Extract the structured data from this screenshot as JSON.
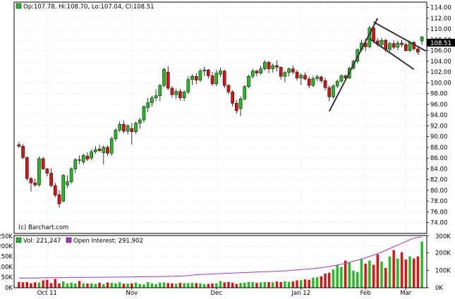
{
  "chart_data": [
    {
      "type": "candlestick",
      "legend": {
        "text": "Op:107.78, Hi:108.70, Lo:107.04, Cl:108.51",
        "color": "#22bb22"
      },
      "watermark": "(c) Barchart.com",
      "last_price_label": "108.51",
      "ylim": [
        72,
        115
      ],
      "y_ticks": [
        "74.00",
        "76.00",
        "78.00",
        "80.00",
        "82.00",
        "84.00",
        "86.00",
        "88.00",
        "90.00",
        "92.00",
        "94.00",
        "96.00",
        "98.00",
        "100.00",
        "102.00",
        "104.00",
        "106.00",
        "108.00",
        "110.00",
        "112.00",
        "114.00"
      ],
      "x_labels": [
        "Oct 11",
        "Nov",
        "Dec",
        "Jan 12",
        "Feb",
        "Mar"
      ],
      "up_color": "#22bb22",
      "down_color": "#dd1111",
      "candles": [
        [
          88.5,
          89.0,
          87.9,
          88.2
        ],
        [
          88.2,
          88.6,
          85.8,
          86.1
        ],
        [
          86.1,
          86.3,
          81.8,
          82.2
        ],
        [
          82.2,
          82.5,
          79.8,
          81.4
        ],
        [
          81.4,
          82.2,
          80.6,
          81.0
        ],
        [
          81.0,
          86.3,
          80.7,
          85.9
        ],
        [
          85.9,
          86.2,
          83.8,
          84.0
        ],
        [
          84.0,
          84.2,
          82.6,
          83.2
        ],
        [
          83.2,
          84.1,
          80.6,
          80.9
        ],
        [
          80.9,
          81.4,
          78.7,
          79.1
        ],
        [
          79.2,
          80.0,
          76.8,
          77.5
        ],
        [
          78.0,
          83.0,
          77.8,
          82.8
        ],
        [
          81.0,
          82.8,
          80.4,
          81.6
        ],
        [
          81.6,
          84.3,
          81.2,
          84.0
        ],
        [
          84.0,
          86.0,
          83.2,
          85.7
        ],
        [
          85.7,
          86.5,
          84.9,
          85.6
        ],
        [
          85.3,
          86.8,
          84.8,
          86.5
        ],
        [
          86.4,
          87.1,
          85.4,
          85.8
        ],
        [
          86.0,
          87.6,
          85.6,
          87.2
        ],
        [
          87.2,
          88.2,
          86.8,
          87.6
        ],
        [
          87.7,
          88.5,
          87.1,
          87.4
        ],
        [
          87.0,
          88.4,
          84.8,
          88.0
        ],
        [
          88.0,
          88.4,
          86.4,
          86.9
        ],
        [
          86.9,
          90.0,
          86.4,
          89.6
        ],
        [
          89.6,
          91.6,
          89.1,
          91.2
        ],
        [
          91.2,
          92.8,
          90.8,
          92.3
        ],
        [
          92.3,
          93.0,
          90.6,
          91.0
        ],
        [
          91.0,
          92.3,
          90.4,
          92.0
        ],
        [
          91.5,
          92.5,
          88.5,
          90.9
        ],
        [
          90.9,
          92.8,
          90.5,
          92.5
        ],
        [
          92.5,
          93.5,
          91.5,
          93.1
        ],
        [
          93.1,
          95.8,
          92.6,
          95.6
        ],
        [
          95.4,
          97.2,
          94.6,
          96.3
        ],
        [
          96.3,
          97.6,
          95.6,
          97.2
        ],
        [
          97.2,
          98.8,
          96.6,
          97.6
        ],
        [
          97.6,
          99.8,
          96.6,
          99.5
        ],
        [
          99.5,
          102.8,
          99.2,
          102.5
        ],
        [
          102.0,
          103.1,
          98.6,
          99.0
        ],
        [
          99.0,
          99.4,
          97.2,
          97.8
        ],
        [
          97.8,
          98.9,
          97.0,
          98.4
        ],
        [
          98.4,
          98.9,
          96.7,
          97.2
        ],
        [
          97.2,
          98.6,
          96.6,
          98.3
        ],
        [
          98.3,
          101.2,
          97.9,
          100.6
        ],
        [
          100.6,
          101.6,
          99.6,
          101.2
        ],
        [
          101.2,
          101.8,
          99.8,
          100.5
        ],
        [
          100.5,
          102.6,
          100.2,
          102.2
        ],
        [
          102.2,
          103.0,
          101.3,
          102.4
        ],
        [
          102.4,
          102.6,
          100.8,
          101.3
        ],
        [
          101.3,
          102.0,
          99.4,
          99.8
        ],
        [
          99.8,
          102.4,
          99.4,
          101.8
        ],
        [
          101.6,
          102.8,
          101.1,
          102.2
        ],
        [
          102.2,
          102.4,
          99.0,
          99.5
        ],
        [
          99.5,
          99.8,
          97.8,
          98.3
        ],
        [
          98.3,
          98.6,
          95.6,
          96.2
        ],
        [
          96.2,
          96.8,
          94.3,
          94.8
        ],
        [
          95.2,
          97.5,
          93.8,
          97.0
        ],
        [
          97.0,
          99.6,
          96.8,
          99.3
        ],
        [
          99.3,
          101.5,
          99.0,
          101.2
        ],
        [
          101.2,
          102.6,
          100.8,
          102.2
        ],
        [
          102.2,
          102.4,
          101.2,
          101.8
        ],
        [
          101.8,
          103.2,
          101.5,
          102.6
        ],
        [
          102.6,
          104.2,
          102.3,
          103.8
        ],
        [
          103.8,
          104.1,
          101.8,
          102.6
        ],
        [
          102.6,
          103.6,
          101.9,
          103.2
        ],
        [
          103.2,
          104.2,
          102.1,
          102.9
        ],
        [
          102.9,
          103.0,
          100.6,
          101.2
        ],
        [
          101.2,
          102.2,
          100.1,
          101.9
        ],
        [
          101.9,
          102.8,
          101.2,
          102.6
        ],
        [
          102.6,
          103.2,
          101.6,
          102.0
        ],
        [
          102.0,
          102.4,
          100.4,
          100.9
        ],
        [
          100.9,
          101.8,
          99.6,
          101.4
        ],
        [
          101.4,
          101.9,
          100.5,
          100.7
        ],
        [
          100.7,
          101.2,
          99.0,
          99.5
        ],
        [
          99.5,
          101.3,
          99.2,
          100.8
        ],
        [
          100.8,
          101.5,
          100.3,
          101.1
        ],
        [
          101.1,
          101.3,
          100.0,
          100.4
        ],
        [
          100.4,
          100.9,
          98.6,
          99.1
        ],
        [
          99.1,
          99.5,
          96.6,
          97.4
        ],
        [
          97.4,
          99.7,
          97.1,
          99.4
        ],
        [
          99.4,
          100.6,
          99.0,
          100.3
        ],
        [
          100.3,
          101.6,
          100.0,
          101.3
        ],
        [
          101.3,
          101.5,
          100.6,
          100.9
        ],
        [
          100.9,
          103.0,
          100.7,
          102.7
        ],
        [
          102.7,
          104.3,
          102.4,
          104.0
        ],
        [
          104.0,
          106.4,
          103.6,
          106.2
        ],
        [
          106.2,
          108.0,
          105.8,
          107.4
        ],
        [
          107.4,
          108.2,
          105.9,
          106.7
        ],
        [
          106.7,
          110.6,
          106.4,
          110.2
        ],
        [
          110.2,
          110.7,
          107.4,
          107.8
        ],
        [
          107.8,
          108.3,
          106.7,
          107.1
        ],
        [
          107.1,
          108.4,
          106.5,
          107.9
        ],
        [
          107.9,
          108.2,
          105.7,
          106.2
        ],
        [
          106.2,
          107.6,
          105.8,
          107.3
        ],
        [
          107.3,
          107.9,
          106.2,
          106.6
        ],
        [
          106.6,
          107.8,
          106.1,
          107.4
        ],
        [
          107.4,
          108.0,
          106.6,
          107.1
        ],
        [
          107.1,
          107.5,
          105.8,
          106.0
        ],
        [
          106.0,
          107.8,
          105.7,
          107.5
        ],
        [
          107.5,
          107.8,
          106.0,
          106.3
        ],
        [
          106.3,
          106.6,
          105.2,
          105.7
        ],
        [
          107.78,
          108.7,
          107.04,
          108.51
        ]
      ],
      "trendlines": [
        {
          "from": [
            77,
            94.7
          ],
          "to": [
            89,
            112.0
          ]
        },
        {
          "from": [
            88,
            111.3
          ],
          "to": [
            101,
            105.9
          ]
        },
        {
          "from": [
            87,
            108.2
          ],
          "to": [
            98,
            102.5
          ]
        }
      ]
    },
    {
      "type": "bar",
      "legend_volume": "Vol: 221,247",
      "legend_open_interest": "Open Interest: 291,902",
      "volume_color": "#22bb22",
      "open_interest_color": "#aa33cc",
      "left_ticks": [
        "0K",
        "50K",
        "100K",
        "150K",
        "200K",
        "250K"
      ],
      "right_ticks": [
        "0K",
        "100K",
        "200K",
        "300K"
      ],
      "volume_max": 250000,
      "open_interest_max": 300000,
      "volume": [
        28000,
        26000,
        27000,
        21000,
        26000,
        25000,
        35000,
        38000,
        22000,
        42000,
        20000,
        30000,
        20000,
        24000,
        20000,
        32000,
        21000,
        20000,
        21000,
        18000,
        24000,
        17000,
        25000,
        23000,
        21000,
        26000,
        19000,
        20000,
        21000,
        24000,
        18000,
        16000,
        27000,
        21000,
        17000,
        24000,
        25000,
        22000,
        21000,
        19000,
        23000,
        22000,
        22000,
        24000,
        22000,
        21000,
        17000,
        18000,
        20000,
        21000,
        32000,
        26000,
        28000,
        24000,
        18000,
        23000,
        24000,
        28000,
        27000,
        23000,
        26000,
        28000,
        27000,
        26000,
        30000,
        27000,
        31000,
        28000,
        30000,
        35000,
        37000,
        40000,
        38000,
        48000,
        50000,
        55000,
        68000,
        72000,
        88000,
        110000,
        100000,
        130000,
        120000,
        82000,
        75000,
        140000,
        115000,
        130000,
        110000,
        160000,
        125000,
        95000,
        150000,
        180000,
        140000,
        170000,
        135000,
        150000,
        140000,
        150000,
        221247
      ],
      "open_interest": [
        55000,
        55000,
        56000,
        56000,
        56000,
        56000,
        57000,
        57000,
        58000,
        58000,
        58000,
        58000,
        58000,
        59000,
        59000,
        59000,
        59000,
        60000,
        60000,
        60000,
        60000,
        61000,
        61000,
        61000,
        61000,
        62000,
        62000,
        62000,
        62000,
        63000,
        63000,
        63000,
        64000,
        64000,
        64000,
        64000,
        65000,
        65000,
        66000,
        66000,
        67000,
        68000,
        70000,
        72000,
        75000,
        76000,
        77000,
        78000,
        79000,
        80000,
        81000,
        82000,
        83000,
        84000,
        85000,
        86000,
        87000,
        88000,
        89000,
        90000,
        91000,
        92000,
        93000,
        94000,
        95000,
        96000,
        97000,
        98000,
        100000,
        102000,
        104000,
        106000,
        108000,
        110000,
        112000,
        115000,
        118000,
        122000,
        126000,
        130000,
        135000,
        140000,
        146000,
        152000,
        158000,
        165000,
        172000,
        180000,
        188000,
        196000,
        205000,
        215000,
        225000,
        235000,
        245000,
        256000,
        266000,
        276000,
        285000,
        290000,
        291902
      ]
    }
  ]
}
